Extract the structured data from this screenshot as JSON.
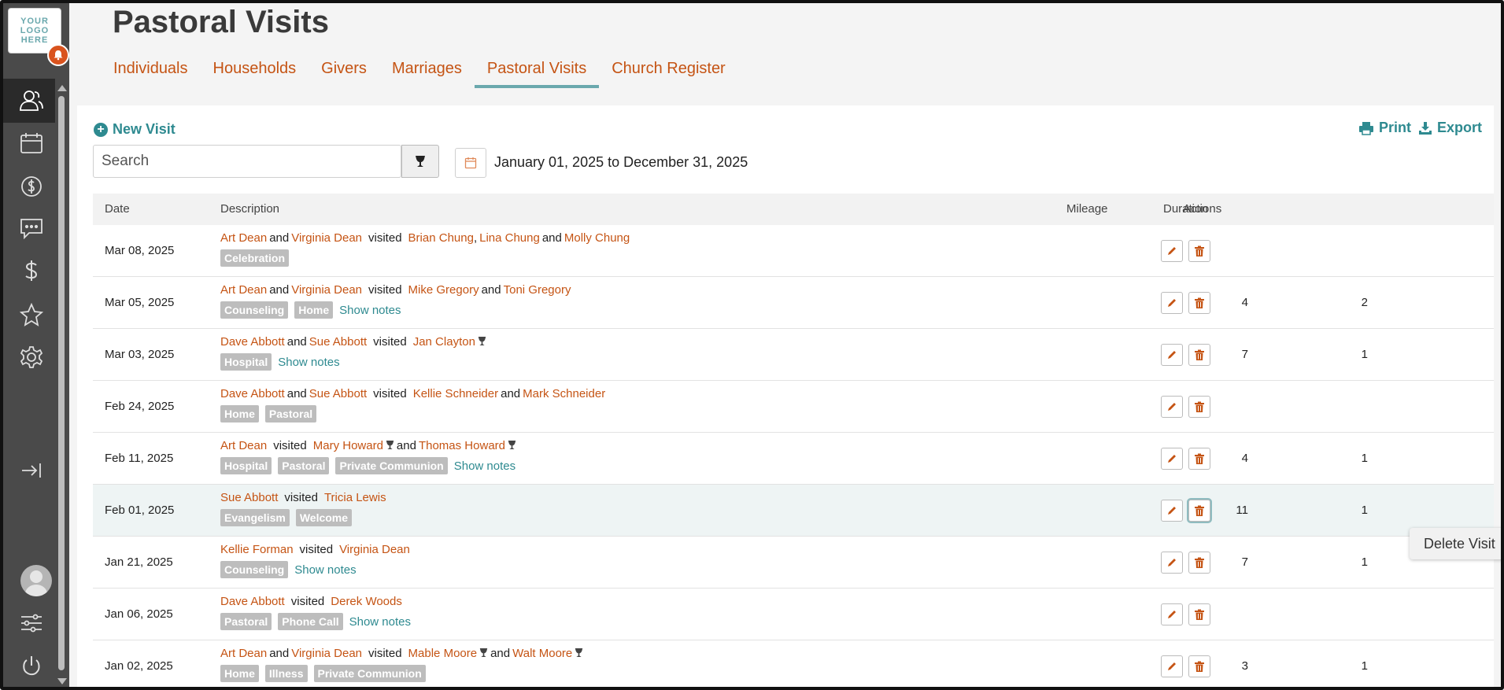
{
  "sidebar": {
    "logo_text": "YOUR LOGO HERE",
    "icons": [
      "people-icon",
      "calendar-icon",
      "donation-icon",
      "chat-icon",
      "dollar-icon",
      "star-icon",
      "gear-icon",
      "collapse-icon",
      "avatar",
      "sliders-icon",
      "power-icon"
    ]
  },
  "header": {
    "title": "Pastoral Visits"
  },
  "tabs": [
    {
      "label": "Individuals"
    },
    {
      "label": "Households"
    },
    {
      "label": "Givers"
    },
    {
      "label": "Marriages"
    },
    {
      "label": "Pastoral Visits",
      "active": true
    },
    {
      "label": "Church Register"
    }
  ],
  "toolbar": {
    "new_visit": "New Visit",
    "print": "Print",
    "export": "Export",
    "search_placeholder": "Search",
    "date_range": "January 01, 2025 to December 31, 2025"
  },
  "table": {
    "columns": {
      "date": "Date",
      "description": "Description",
      "mileage": "Mileage",
      "duration": "Duration",
      "actions": "Actions"
    },
    "rows": [
      {
        "date": "Mar 08, 2025",
        "visitors": [
          "Art Dean",
          "and",
          "Virginia Dean"
        ],
        "visited": "visited",
        "visitees": [
          "Brian Chung",
          ",",
          "Lina Chung",
          "and",
          "Molly Chung"
        ],
        "tags": [
          "Celebration"
        ],
        "notes": "",
        "mileage": "",
        "duration": ""
      },
      {
        "date": "Mar 05, 2025",
        "visitors": [
          "Art Dean",
          "and",
          "Virginia Dean"
        ],
        "visited": "visited",
        "visitees": [
          "Mike Gregory",
          "and",
          "Toni Gregory"
        ],
        "tags": [
          "Counseling",
          "Home"
        ],
        "notes": "Show notes",
        "mileage": "4",
        "duration": "2"
      },
      {
        "date": "Mar 03, 2025",
        "visitors": [
          "Dave Abbott",
          "and",
          "Sue Abbott"
        ],
        "visited": "visited",
        "visitees": [
          "Jan Clayton*"
        ],
        "tags": [
          "Hospital"
        ],
        "notes": "Show notes",
        "mileage": "7",
        "duration": "1"
      },
      {
        "date": "Feb 24, 2025",
        "visitors": [
          "Dave Abbott",
          "and",
          "Sue Abbott"
        ],
        "visited": "visited",
        "visitees": [
          "Kellie Schneider",
          "and",
          "Mark Schneider"
        ],
        "tags": [
          "Home",
          "Pastoral"
        ],
        "notes": "",
        "mileage": "",
        "duration": ""
      },
      {
        "date": "Feb 11, 2025",
        "visitors": [
          "Art Dean"
        ],
        "visited": "visited",
        "visitees": [
          "Mary Howard*",
          "and",
          "Thomas Howard*"
        ],
        "tags": [
          "Hospital",
          "Pastoral",
          "Private Communion"
        ],
        "notes": "Show notes",
        "mileage": "4",
        "duration": "1"
      },
      {
        "date": "Feb 01, 2025",
        "visitors": [
          "Sue Abbott"
        ],
        "visited": "visited",
        "visitees": [
          "Tricia Lewis"
        ],
        "tags": [
          "Evangelism",
          "Welcome"
        ],
        "notes": "",
        "mileage": "11",
        "duration": "1",
        "hover": true
      },
      {
        "date": "Jan 21, 2025",
        "visitors": [
          "Kellie Forman"
        ],
        "visited": "visited",
        "visitees": [
          "Virginia Dean"
        ],
        "tags": [
          "Counseling"
        ],
        "notes": "Show notes",
        "mileage": "7",
        "duration": "1"
      },
      {
        "date": "Jan 06, 2025",
        "visitors": [
          "Dave Abbott"
        ],
        "visited": "visited",
        "visitees": [
          "Derek Woods"
        ],
        "tags": [
          "Pastoral",
          "Phone Call"
        ],
        "notes": "Show notes",
        "mileage": "",
        "duration": ""
      },
      {
        "date": "Jan 02, 2025",
        "visitors": [
          "Art Dean",
          "and",
          "Virginia Dean"
        ],
        "visited": "visited",
        "visitees": [
          "Mable Moore*",
          "and",
          "Walt Moore*"
        ],
        "tags": [
          "Home",
          "Illness",
          "Private Communion"
        ],
        "notes": "",
        "mileage": "3",
        "duration": "1"
      }
    ]
  },
  "tooltip": {
    "text": "Delete Visit"
  },
  "colors": {
    "link": "#c55414",
    "accent": "#2e8a90",
    "tab_underline": "#6aa8ad",
    "tag": "#bdbdbd"
  }
}
